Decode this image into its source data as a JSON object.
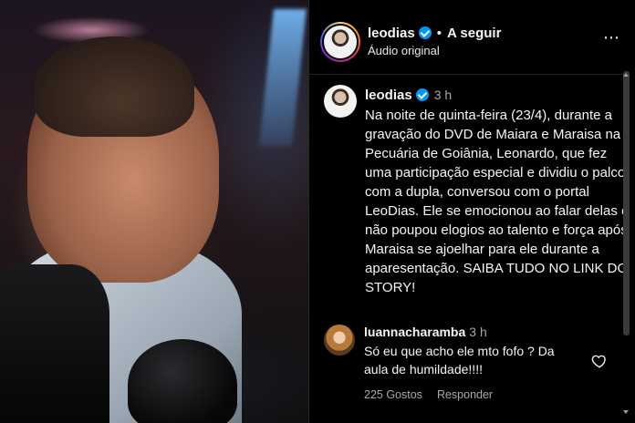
{
  "header": {
    "username": "leodias",
    "separator": "•",
    "follow_label": "A seguir",
    "audio_label": "Áudio original",
    "more_icon": "⋯"
  },
  "caption": {
    "username": "leodias",
    "time": "3 h",
    "text": "Na noite de quinta-feira (23/4), durante a gravação do DVD de Maiara e Maraisa na Pecuária de Goiânia, Leonardo, que fez uma participação especial e dividiu o palco com a dupla, conversou com o portal LeoDias. Ele se emocionou ao falar delas e não poupou elogios ao talento e força após Maraisa se ajoelhar para ele durante a aparesentação. SAIBA TUDO NO LINK DO STORY!"
  },
  "comment": {
    "username": "luannacharamba",
    "time": "3 h",
    "text": "Só eu que acho ele mto fofo ? Da aula de humildade!!!!",
    "likes": "225 Gostos",
    "reply_label": "Responder"
  },
  "icons": {
    "verified": "verified-badge-icon",
    "heart": "heart-icon",
    "more": "more-options-icon"
  },
  "colors": {
    "background": "#000000",
    "text": "#f5f5f5",
    "secondary_text": "#a8a8a8",
    "verified_blue": "#0095f6"
  }
}
